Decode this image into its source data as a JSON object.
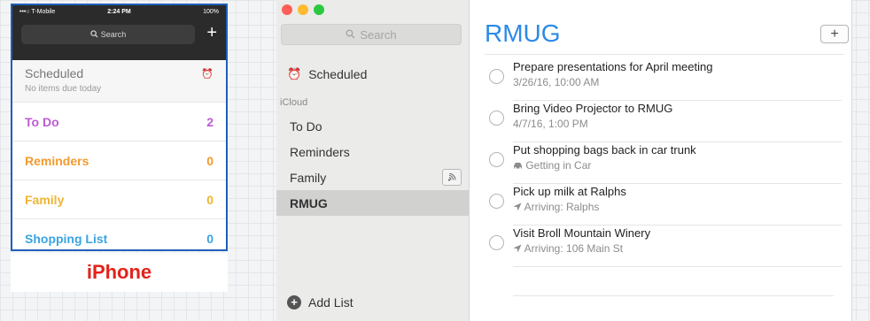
{
  "iphone": {
    "status": {
      "carrier": "•••○ T-Mobile",
      "time": "2:24 PM",
      "battery": "100%"
    },
    "search_placeholder": "Search",
    "add_symbol": "+",
    "scheduled": {
      "label": "Scheduled",
      "subtitle": "No items due today",
      "icon": "alarm-clock-icon"
    },
    "lists": [
      {
        "name": "To Do",
        "count": "2",
        "color": "#bd5bd3"
      },
      {
        "name": "Reminders",
        "count": "0",
        "color": "#f39a2e"
      },
      {
        "name": "Family",
        "count": "0",
        "color": "#f0b431"
      },
      {
        "name": "Shopping List",
        "count": "0",
        "color": "#3aa4e3"
      }
    ],
    "label": "iPhone"
  },
  "mac": {
    "search_placeholder": "Search",
    "scheduled_label": "Scheduled",
    "account_header": "iCloud",
    "lists": [
      {
        "name": "To Do",
        "selected": false,
        "shared": false
      },
      {
        "name": "Reminders",
        "selected": false,
        "shared": false
      },
      {
        "name": "Family",
        "selected": false,
        "shared": true
      },
      {
        "name": "RMUG",
        "selected": true,
        "shared": false
      }
    ],
    "add_list_label": "Add List",
    "list_title": "RMUG",
    "add_button": "+",
    "accent": "#2d8ae5",
    "tasks": [
      {
        "title": "Prepare presentations for April meeting",
        "detail": "3/26/16, 10:00 AM",
        "icon": ""
      },
      {
        "title": "Bring Video Projector to RMUG",
        "detail": "4/7/16, 1:00 PM",
        "icon": ""
      },
      {
        "title": "Put shopping bags back in car trunk",
        "detail": "Getting in Car",
        "icon": "car-icon"
      },
      {
        "title": "Pick up milk at Ralphs",
        "detail": "Arriving: Ralphs",
        "icon": "location-arrow-icon"
      },
      {
        "title": "Visit Broll Mountain Winery",
        "detail": "Arriving: 106 Main St",
        "icon": "location-arrow-icon"
      }
    ]
  }
}
